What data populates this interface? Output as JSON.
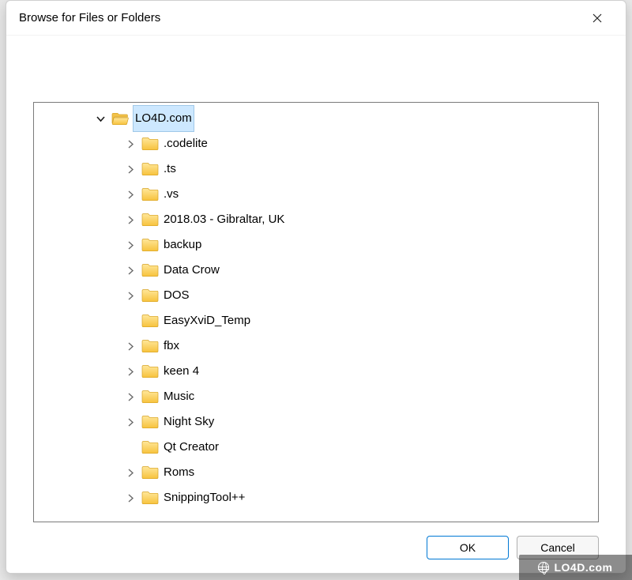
{
  "window": {
    "title": "Browse for Files or Folders"
  },
  "tree": {
    "root": {
      "label": "LO4D.com",
      "expanded": true,
      "selected": true,
      "hasChildren": true
    },
    "children": [
      {
        "label": ".codelite",
        "hasChildren": true
      },
      {
        "label": ".ts",
        "hasChildren": true
      },
      {
        "label": ".vs",
        "hasChildren": true
      },
      {
        "label": "2018.03 - Gibraltar, UK",
        "hasChildren": true
      },
      {
        "label": "backup",
        "hasChildren": true
      },
      {
        "label": "Data Crow",
        "hasChildren": true
      },
      {
        "label": "DOS",
        "hasChildren": true
      },
      {
        "label": "EasyXviD_Temp",
        "hasChildren": false
      },
      {
        "label": "fbx",
        "hasChildren": true
      },
      {
        "label": "keen 4",
        "hasChildren": true
      },
      {
        "label": "Music",
        "hasChildren": true
      },
      {
        "label": "Night Sky",
        "hasChildren": true
      },
      {
        "label": "Qt Creator",
        "hasChildren": false
      },
      {
        "label": "Roms",
        "hasChildren": true
      },
      {
        "label": "SnippingTool++",
        "hasChildren": true
      }
    ]
  },
  "buttons": {
    "ok": "OK",
    "cancel": "Cancel"
  },
  "watermark": "LO4D.com"
}
